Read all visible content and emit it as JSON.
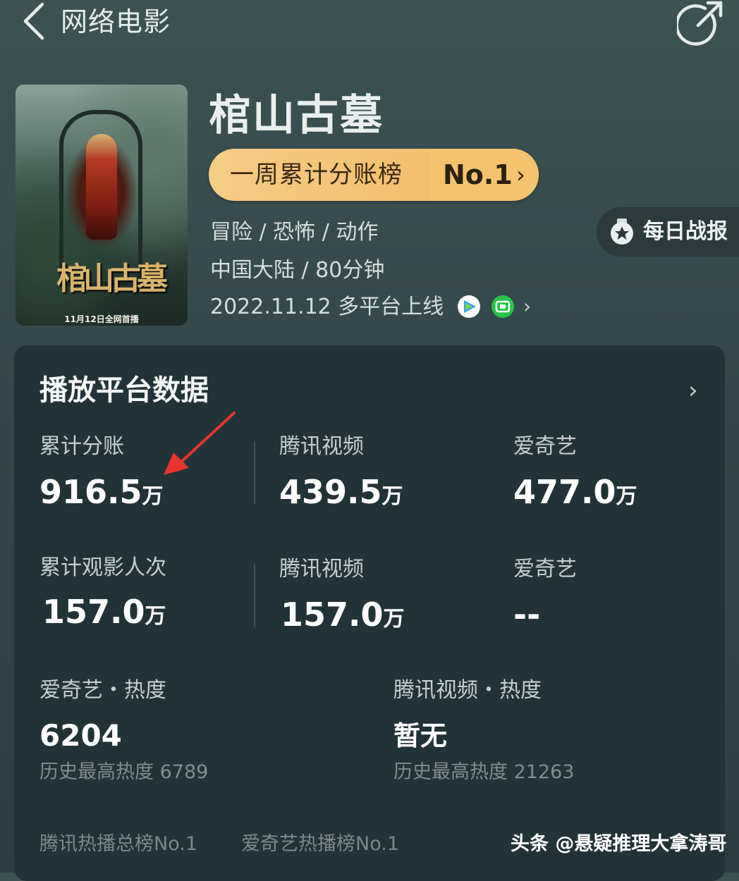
{
  "header": {
    "title": "网络电影",
    "back_icon": "chevron-left-icon",
    "share_icon": "share-icon"
  },
  "poster": {
    "title_text": "棺山古墓",
    "release_text": "11月12日全网首播"
  },
  "movie": {
    "title": "棺山古墓",
    "rank_label": "一周累计分账榜",
    "rank_value": "No.1",
    "rank_chevron": "›",
    "genre": "冒险 / 恐怖 / 动作",
    "region_duration": "中国大陆 / 80分钟",
    "release": "2022.11.12 多平台上线",
    "release_chevron": "›",
    "platforms": [
      "tencent-video-icon",
      "iqiyi-icon"
    ]
  },
  "daily_report": {
    "label": "每日战报",
    "icon": "medal-icon"
  },
  "card": {
    "title": "播放平台数据",
    "chevron": "›",
    "revenue": {
      "total_label": "累计分账",
      "total_value": "916.5",
      "total_unit": "万",
      "tencent_label": "腾讯视频",
      "tencent_value": "439.5",
      "tencent_unit": "万",
      "iqiyi_label": "爱奇艺",
      "iqiyi_value": "477.0",
      "iqiyi_unit": "万"
    },
    "viewers": {
      "total_label": "累计观影人次",
      "total_value": "157.0",
      "total_unit": "万",
      "tencent_label": "腾讯视频",
      "tencent_value": "157.0",
      "tencent_unit": "万",
      "iqiyi_label": "爱奇艺",
      "iqiyi_value": "--"
    },
    "heat": {
      "iqiyi_label": "爱奇艺・热度",
      "iqiyi_value": "6204",
      "iqiyi_sub": "历史最高热度 6789",
      "tencent_label": "腾讯视频・热度",
      "tencent_value": "暂无",
      "tencent_sub": "历史最高热度 21263"
    },
    "footer_tags": [
      "腾讯热播总榜No.1",
      "爱奇艺热播榜No.1"
    ]
  },
  "watermark": "头条 @悬疑推理大拿涛哥",
  "colors": {
    "background": "#33474a",
    "card": "#223338",
    "rank_badge": "#f0b862",
    "annotation_arrow": "#e8342e"
  }
}
